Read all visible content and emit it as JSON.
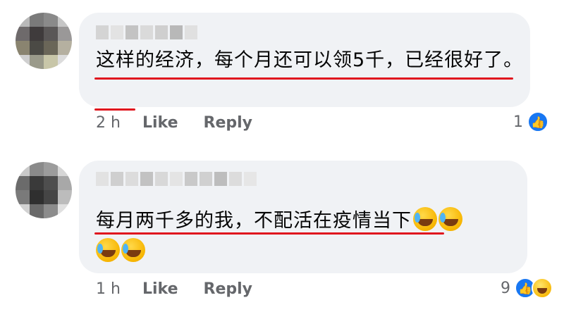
{
  "comments": [
    {
      "text": "这样的经济，每个月还可以领5千，已经很好了。",
      "time": "2 h",
      "like_label": "Like",
      "reply_label": "Reply",
      "reaction_count": "1",
      "reactions": [
        "like-icon"
      ]
    },
    {
      "text": "每月两千多的我，不配活在疫情当下",
      "time": "1 h",
      "like_label": "Like",
      "reply_label": "Reply",
      "reaction_count": "9",
      "reactions": [
        "like-icon",
        "haha-icon"
      ],
      "emojis": [
        "rolling-laughing-emoji",
        "rolling-laughing-emoji",
        "rolling-laughing-emoji",
        "rolling-laughing-emoji"
      ]
    }
  ],
  "colors": {
    "bubble": "#f0f2f5",
    "underline": "#e0161e",
    "meta": "#65676b",
    "like": "#1877f2"
  }
}
